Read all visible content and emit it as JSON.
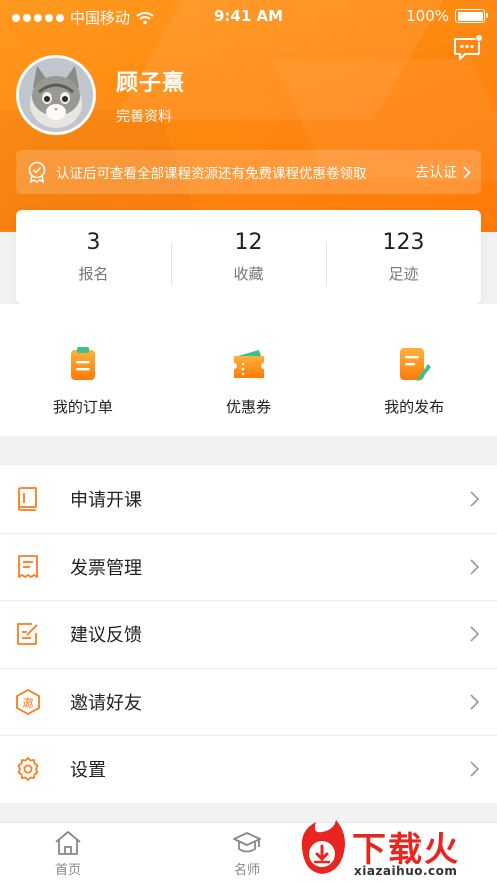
{
  "status_bar": {
    "carrier": "中国移动",
    "time": "9:41 AM",
    "battery": "100%"
  },
  "profile": {
    "name": "顾子熹",
    "complete_link": "完善资料"
  },
  "cert_banner": {
    "text": "认证后可查看全部课程资源还有免费课程优惠卷领取",
    "action": "去认证"
  },
  "stats": [
    {
      "value": "3",
      "label": "报名"
    },
    {
      "value": "12",
      "label": "收藏"
    },
    {
      "value": "123",
      "label": "足迹"
    }
  ],
  "quick_actions": [
    {
      "label": "我的订单",
      "icon": "order-icon"
    },
    {
      "label": "优惠券",
      "icon": "coupon-icon"
    },
    {
      "label": "我的发布",
      "icon": "publish-icon"
    }
  ],
  "menu": [
    {
      "label": "申请开课",
      "icon": "book-icon"
    },
    {
      "label": "发票管理",
      "icon": "receipt-icon"
    },
    {
      "label": "建议反馈",
      "icon": "feedback-icon"
    },
    {
      "label": "邀请好友",
      "icon": "invite-icon"
    },
    {
      "label": "设置",
      "icon": "gear-icon"
    }
  ],
  "tabbar": [
    {
      "label": "首页",
      "icon": "home-icon"
    },
    {
      "label": "名师",
      "icon": "graduation-cap-icon"
    }
  ],
  "watermark": {
    "title": "下载火",
    "site": "xiazaihuo.com"
  },
  "colors": {
    "accent": "#ff8a12",
    "text": "#222222",
    "muted": "#777777",
    "watermark": "#e8261f"
  }
}
